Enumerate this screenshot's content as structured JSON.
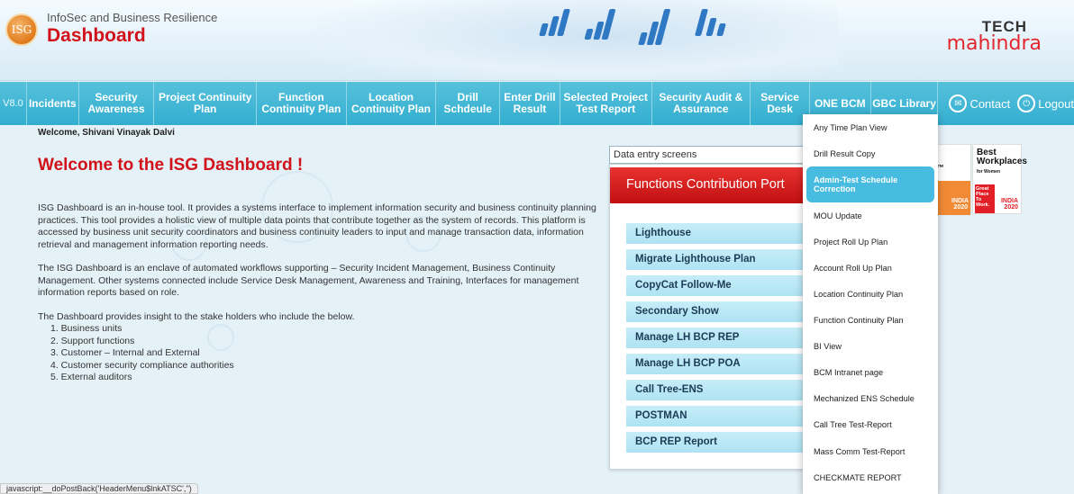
{
  "header": {
    "logo_text": "ISG",
    "subtitle": "InfoSec and Business Resilience",
    "title": "Dashboard",
    "brand_top": "TECH",
    "brand_bottom": "mahindra"
  },
  "nav": {
    "version": "V8.0",
    "items": [
      {
        "label": "Incidents"
      },
      {
        "label": "Security Awareness"
      },
      {
        "label": "Project Continuity Plan"
      },
      {
        "label": "Function Continuity Plan"
      },
      {
        "label": "Location Continuity Plan"
      },
      {
        "label": "Drill Schdeule"
      },
      {
        "label": "Enter Drill Result"
      },
      {
        "label": "Selected Project Test Report"
      },
      {
        "label": "Security Audit & Assurance"
      },
      {
        "label": "Service Desk"
      },
      {
        "label": "ONE BCM"
      },
      {
        "label": "GBC Library"
      }
    ],
    "contact": "Contact",
    "logout": "Logout"
  },
  "welcome_user": "Welcome, Shivani Vinayak Dalvi",
  "welcome_title": "Welcome to the ISG Dashboard !",
  "content": {
    "para1": "ISG Dashboard is an in-house tool. It provides a systems interface to implement information security and business continuity planning practices. This tool provides a holistic view of multiple data points that contribute together as the system of records. This platform is accessed by business unit security coordinators and business continuity leaders to input and manage transaction data, information retrieval and management information reporting needs.",
    "para2": "The ISG Dashboard is an enclave of automated workflows supporting – Security Incident Management, Business Continuity Management. Other systems connected include Service Desk Management, Awareness and Training, Interfaces for management information reports based on role.",
    "para3": "The Dashboard provides insight to the stake holders who include the below.",
    "list": [
      "1. Business units",
      "2. Support functions",
      "3. Customer – Internal and External",
      "4. Customer security compliance authorities",
      "5. External auditors"
    ]
  },
  "panel": {
    "select_value": "Data entry screens",
    "banner": "Functions Contribution Port",
    "items": [
      "Lighthouse",
      "Migrate Lighthouse Plan",
      "CopyCat Follow-Me",
      "Secondary Show",
      "Manage LH BCP REP",
      "Manage LH BCP POA",
      "Call Tree-ENS",
      "POSTMAN",
      "BCP REP Report"
    ]
  },
  "awards": {
    "a1_title": "ces™",
    "a1_india": "INDIA 2020",
    "a2_title": "Best Workplaces",
    "a2_sub": "for Women",
    "a2_gptw": "Great Place To Work.",
    "a2_india": "INDIA 2020"
  },
  "menu": {
    "items": [
      "Any Time Plan View",
      "Drill Result Copy",
      "Admin-Test Schedule Correction",
      "MOU Update",
      "Project Roll Up Plan",
      "Account Roll Up Plan",
      "Location Continuity Plan",
      "Function Continuity Plan",
      "BI View",
      "BCM Intranet page",
      "Mechanized ENS Schedule",
      "Call Tree Test-Report",
      "Mass Comm Test-Report",
      "CHECKMATE REPORT"
    ],
    "active_index": 2
  },
  "status_bar": "javascript:__doPostBack('HeaderMenu$lnkATSC','')",
  "colors": {
    "nav_bg": "#3db4d4",
    "title_red": "#d1121b",
    "panel_item_bg": "#b9e8f5",
    "menu_active": "#47bce0"
  }
}
